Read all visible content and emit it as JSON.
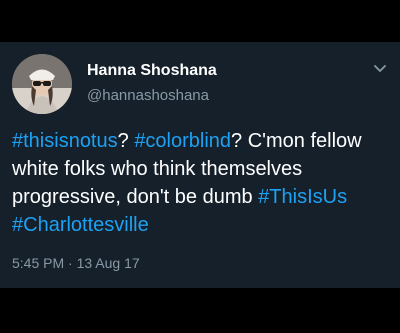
{
  "user": {
    "display_name": "Hanna Shoshana",
    "handle": "@hannashoshana"
  },
  "tweet": {
    "hashtag_1": "#thisisnotus",
    "text_1": "? ",
    "hashtag_2": "#colorblind",
    "text_2": "? C'mon fellow white folks who think themselves progressive, don't be dumb ",
    "hashtag_3": "#ThisIsUs",
    "hashtag_4": "#Charlottesville",
    "time": "5:45 PM",
    "separator": " · ",
    "date": "13 Aug 17"
  },
  "icons": {
    "menu": "chevron-down-icon"
  },
  "colors": {
    "card_background": "#15202b",
    "page_background": "#000000",
    "hashtag": "#1da1f2",
    "muted_text": "#8899a6",
    "primary_text": "#ffffff"
  }
}
